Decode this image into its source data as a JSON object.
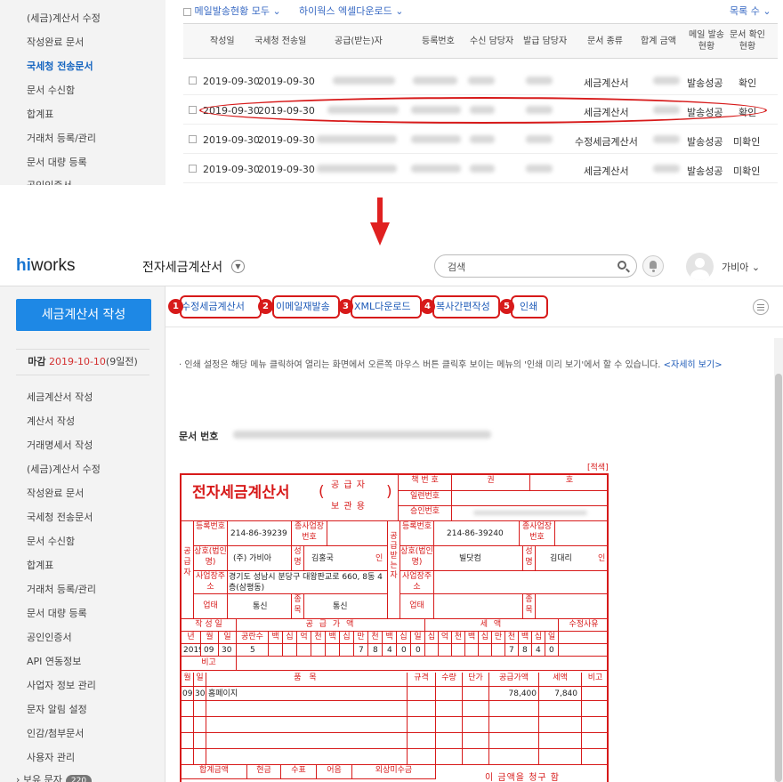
{
  "top": {
    "sidebar": [
      "(세금)계산서 수정",
      "작성완료 문서",
      "국세청 전송문서",
      "문서 수신함",
      "합계표",
      "거래처 등록/관리",
      "문서 대량 등록",
      "공인인증서"
    ],
    "sidebar_active_index": 2,
    "toolbar": {
      "mail_status": "메일발송현황 모두",
      "excel": "하이웍스 엑셀다운로드",
      "list_count": "목록 수"
    },
    "columns": [
      "작성일",
      "국세청 전송일",
      "공급(받는)자",
      "등록번호",
      "수신 담당자",
      "발급 담당자",
      "문서 종류",
      "합계 금액",
      "메일 발송 현황",
      "문서 확인 현황"
    ],
    "rows": [
      {
        "date": "2019-09-30",
        "sent": "2019-09-30",
        "kind": "세금계산서",
        "mail": "발송성공",
        "confirm": "확인"
      },
      {
        "date": "2019-09-30",
        "sent": "2019-09-30",
        "kind": "세금계산서",
        "mail": "발송성공",
        "confirm": "확인"
      },
      {
        "date": "2019-09-30",
        "sent": "2019-09-30",
        "kind": "수정세금계산서",
        "mail": "발송성공",
        "confirm": "미확인"
      },
      {
        "date": "2019-09-30",
        "sent": "2019-09-30",
        "kind": "세금계산서",
        "mail": "발송성공",
        "confirm": "미확인"
      }
    ],
    "highlight_row_index": 1
  },
  "header": {
    "logo_prefix": "hi",
    "logo_suffix": "works",
    "app_title": "전자세금계산서",
    "search_placeholder": "검색",
    "user": "가비아"
  },
  "sidebar": {
    "write_button": "세금계산서 작성",
    "deadline_label": "마감",
    "deadline_date": "2019-10-10",
    "deadline_remain": "(9일전)",
    "items": [
      "세금계산서 작성",
      "계산서 작성",
      "거래명세서 작성",
      "(세금)계산서 수정",
      "작성완료 문서",
      "국세청 전송문서",
      "문서 수신함",
      "합계표",
      "거래처 등록/관리",
      "문서 대량 등록",
      "공인인증서",
      "API 연동정보",
      "사업자 정보 관리",
      "문자 알림 설정",
      "인감/첨부문서",
      "사용자 관리",
      "보유 문자"
    ],
    "sms_badge": "220"
  },
  "toolbar": {
    "buttons": [
      {
        "num": "1",
        "label": "수정세금계산서"
      },
      {
        "num": "2",
        "label": "이메일재발송"
      },
      {
        "num": "3",
        "label": "XML다운로드"
      },
      {
        "num": "4",
        "label": "복사간편작성"
      },
      {
        "num": "5",
        "label": "인쇄"
      }
    ]
  },
  "notice": {
    "text": "· 인쇄 설정은 해당 메뉴 클릭하여 열리는 화면에서 오른쪽 마우스 버튼 클릭후 보이는 메뉴의 '인쇄 미리 보기'에서 할 수 있습니다.",
    "link": "<자세히 보기>"
  },
  "docno_label": "문서 번호",
  "invoice": {
    "copy_tag": "[적색]",
    "title": "전자세금계산서",
    "subtitle_top": "공 급 자",
    "subtitle_bottom": "보 관 용",
    "book_no": "책 번 호",
    "book_kwon": "권",
    "book_ho": "호",
    "serial_no": "일련번호",
    "approval_no": "승인번호",
    "supplier_side": "공급자",
    "receiver_side": "공급받는자",
    "reg_no_label": "등록번호",
    "sub_biz_label": "종사업장번호",
    "name_label": "상호(법인명)",
    "rep_label": "성명",
    "addr_label": "사업장주소",
    "type_label": "업태",
    "item_label": "종목",
    "seal": "인",
    "supplier": {
      "reg_no": "214-86-39239",
      "name": "(주) 가비아",
      "rep": "김홍국",
      "addr": "경기도 성남시 분당구 대왕판교로 660, 8동 4층(삼평동)",
      "type": "통신",
      "item": "통신"
    },
    "receiver": {
      "reg_no": "214-86-39240",
      "name": "빌닷컴",
      "rep": "김대리"
    },
    "sec_written": "작 성 일",
    "sec_supply": "공 급 가 액",
    "sec_tax": "세 액",
    "sec_reason": "수정사유",
    "date_heads": [
      "년",
      "월",
      "일"
    ],
    "space_head": "공란수",
    "digits": [
      "백",
      "십",
      "억",
      "천",
      "백",
      "십",
      "만",
      "천",
      "백",
      "십",
      "일"
    ],
    "tax_digits": [
      "십",
      "억",
      "천",
      "백",
      "십",
      "만",
      "천",
      "백",
      "십",
      "일"
    ],
    "year": "2019",
    "month": "09",
    "day": "30",
    "spaces": "5",
    "supply_digits": [
      "7",
      "8",
      "4",
      "0",
      "0"
    ],
    "tax_digit_vals": [
      "7",
      "8",
      "4",
      "0"
    ],
    "note_label": "비고",
    "item_heads": [
      "월",
      "일",
      "품 목",
      "규격",
      "수량",
      "단가",
      "공급가액",
      "세액",
      "비고"
    ],
    "item_row": {
      "m": "09",
      "d": "30",
      "name": "홈페이지",
      "supply": "78,400",
      "tax": "7,840"
    },
    "total_heads": [
      "합계금액",
      "현금",
      "수표",
      "어음",
      "외상미수금"
    ],
    "claim": "이 금액을 청구 함"
  }
}
